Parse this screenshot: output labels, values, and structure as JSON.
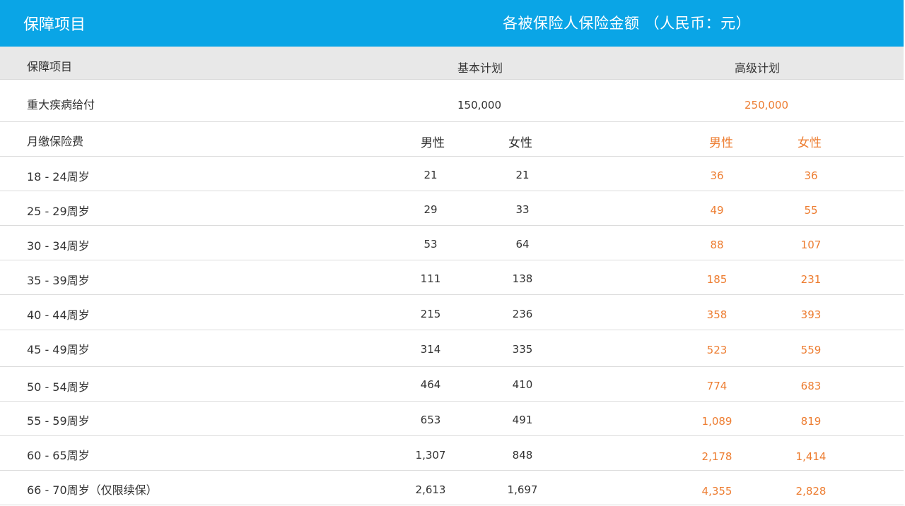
{
  "banner": {
    "left_title": "保障项目",
    "right_title": "各被保险人保险金额 （人民币：元）"
  },
  "header": {
    "col_item": "保障项目",
    "col_basic": "基本计划",
    "col_premium": "高级计划"
  },
  "benefit_row": {
    "label": "重大疾病给付",
    "basic": "150,000",
    "premium": "250,000"
  },
  "subheader": {
    "label": "月缴保险费",
    "basic_male": "男性",
    "basic_female": "女性",
    "premium_male": "男性",
    "premium_female": "女性"
  },
  "rows": [
    {
      "age": "18 - 24周岁",
      "basic_male": "21",
      "basic_female": "21",
      "premium_male": "36",
      "premium_female": "36"
    },
    {
      "age": "25 - 29周岁",
      "basic_male": "29",
      "basic_female": "33",
      "premium_male": "49",
      "premium_female": "55"
    },
    {
      "age": "30 - 34周岁",
      "basic_male": "53",
      "basic_female": "64",
      "premium_male": "88",
      "premium_female": "107"
    },
    {
      "age": "35 - 39周岁",
      "basic_male": "111",
      "basic_female": "138",
      "premium_male": "185",
      "premium_female": "231"
    },
    {
      "age": "40 - 44周岁",
      "basic_male": "215",
      "basic_female": "236",
      "premium_male": "358",
      "premium_female": "393"
    },
    {
      "age": "45 - 49周岁",
      "basic_male": "314",
      "basic_female": "335",
      "premium_male": "523",
      "premium_female": "559"
    },
    {
      "age": "50 - 54周岁",
      "basic_male": "464",
      "basic_female": "410",
      "premium_male": "774",
      "premium_female": "683"
    },
    {
      "age": "55 - 59周岁",
      "basic_male": "653",
      "basic_female": "491",
      "premium_male": "1,089",
      "premium_female": "819"
    },
    {
      "age": "60 - 65周岁",
      "basic_male": "1,307",
      "basic_female": "848",
      "premium_male": "2,178",
      "premium_female": "1,414"
    },
    {
      "age": "66 - 70周岁（仅限续保）",
      "basic_male": "2,613",
      "basic_female": "1,697",
      "premium_male": "4,355",
      "premium_female": "2,828"
    }
  ],
  "colors": {
    "banner_bg": "#0aa5e6",
    "header_bg": "#e8e8e8",
    "premium_text": "#ed7d31"
  }
}
